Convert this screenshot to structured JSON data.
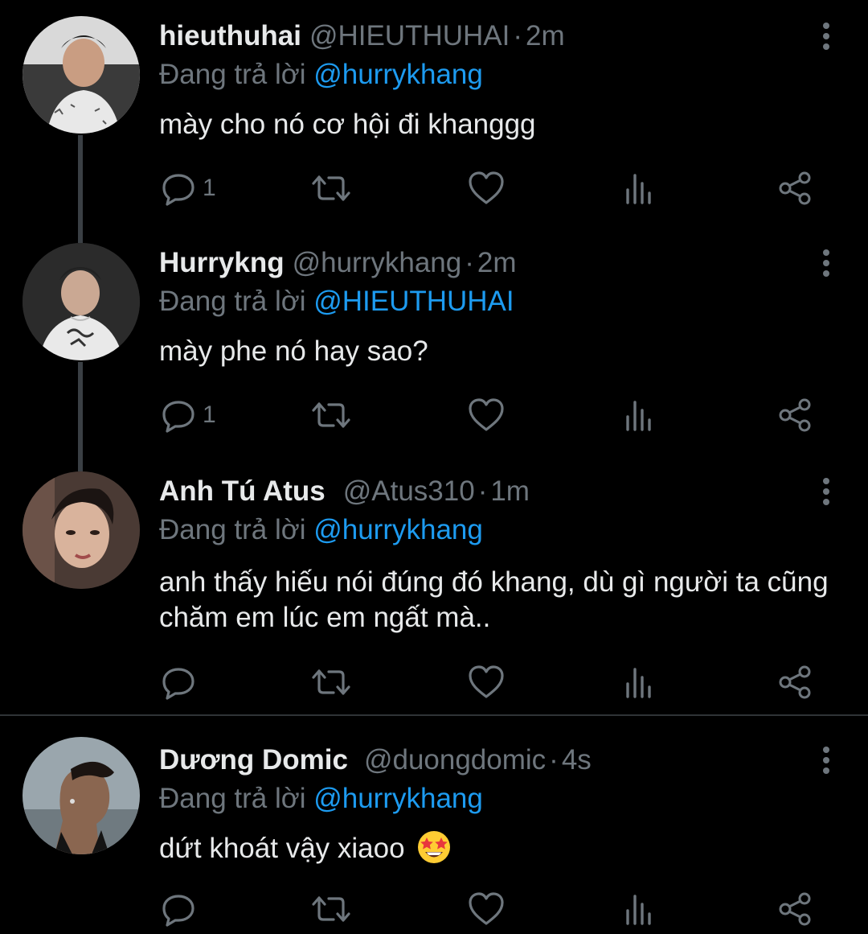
{
  "reply_prefix": "Đang trả lời",
  "colors": {
    "background": "#000000",
    "text": "#e7e9ea",
    "muted": "#6e767d",
    "mention": "#1d9bf0",
    "thread_line": "#3a3f44"
  },
  "tweets": [
    {
      "name": "hieuthuhai",
      "handle": "@HIEUTHUHAI",
      "separator": "·",
      "time": "2m",
      "reply_to": "@hurrykhang",
      "text": "mày cho nó cơ hội đi khanggg",
      "reply_count": "1",
      "avatar": "avatar-photo-hieuthuhai"
    },
    {
      "name": "Hurrykng",
      "handle": "@hurrykhang",
      "separator": "·",
      "time": "2m",
      "reply_to": "@HIEUTHUHAI",
      "text": "mày phe nó hay sao?",
      "reply_count": "1",
      "avatar": "avatar-photo-hurrykng"
    },
    {
      "name": "Anh Tú Atus",
      "handle": "@Atus310",
      "separator": "·",
      "time": "1m",
      "reply_to": "@hurrykhang",
      "text": "anh thấy hiếu nói đúng đó khang, dù gì người ta cũng chăm em lúc em ngất mà..",
      "reply_count": "",
      "avatar": "avatar-photo-atus"
    },
    {
      "name": "Dương Domic",
      "handle": "@duongdomic",
      "separator": "·",
      "time": "4s",
      "reply_to": "@hurrykhang",
      "text": "dứt khoát vậy xiaoo",
      "emoji": "star-struck-emoji",
      "reply_count": "",
      "avatar": "avatar-photo-duongdomic"
    }
  ],
  "action_icons": [
    "reply-icon",
    "retweet-icon",
    "like-icon",
    "views-icon",
    "share-icon"
  ]
}
